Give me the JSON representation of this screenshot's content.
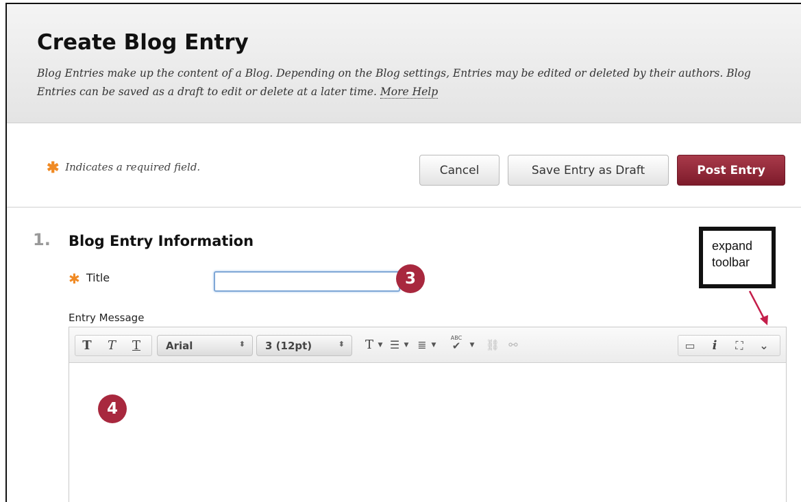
{
  "page": {
    "title": "Create Blog Entry",
    "description": "Blog Entries make up the content of a Blog. Depending on the Blog settings, Entries may be edited or deleted by their authors. Blog Entries can be saved as a draft to edit or delete at a later time.",
    "more_help": "More Help"
  },
  "actions": {
    "required_note": "Indicates a required field.",
    "required_symbol": "✱",
    "cancel": "Cancel",
    "save_draft": "Save Entry as Draft",
    "post": "Post Entry",
    "post_color": "#8c2232"
  },
  "section": {
    "number": "1.",
    "title": "Blog Entry Information",
    "title_label": "Title",
    "title_value": "",
    "entry_label": "Entry Message"
  },
  "toolbar": {
    "font_family": "Arial",
    "font_size": "3 (12pt)",
    "bold_glyph": "T",
    "italic_glyph": "T",
    "underline_glyph": "T",
    "text_color_glyph": "T",
    "info_glyph": "i",
    "spell_glyph": "ABC"
  },
  "annotations": {
    "badge_3": "3",
    "badge_4": "4",
    "note_line1": "expand",
    "note_line2": "toolbar",
    "badge_color": "#a8283e"
  },
  "editor": {
    "content": ""
  }
}
